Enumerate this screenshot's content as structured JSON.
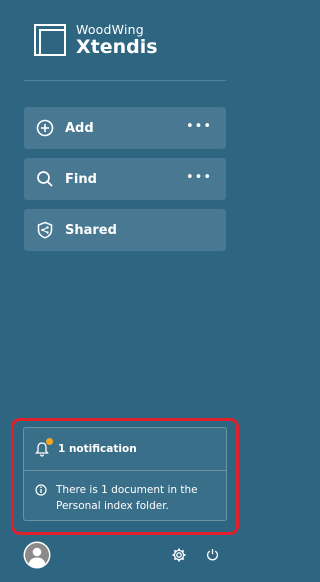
{
  "logo": {
    "brand": "WoodWing",
    "product": "Xtendis"
  },
  "nav": {
    "items": [
      {
        "label": "Add",
        "icon": "plus-circle-icon",
        "more": "•••"
      },
      {
        "label": "Find",
        "icon": "search-icon",
        "more": "•••"
      },
      {
        "label": "Shared",
        "icon": "share-shield-icon"
      }
    ]
  },
  "notifications": {
    "title": "1 notification",
    "message": "There is 1 document in the Personal index folder.",
    "badge_color": "#f5a623",
    "highlight_color": "#e0202a"
  },
  "colors": {
    "background": "#2e6682"
  }
}
